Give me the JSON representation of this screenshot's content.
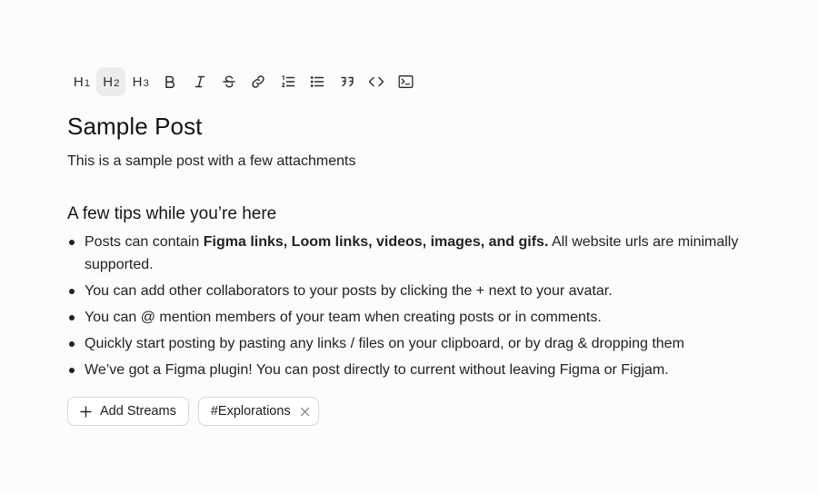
{
  "toolbar": {
    "h1": {
      "main": "H",
      "sub": "1"
    },
    "h2": {
      "main": "H",
      "sub": "2"
    },
    "h3": {
      "main": "H",
      "sub": "3"
    },
    "bold": "B",
    "buttons": [
      "heading-1",
      "heading-2",
      "heading-3",
      "bold",
      "italic",
      "strikethrough",
      "link",
      "ordered-list",
      "bullet-list",
      "quote",
      "code",
      "code-block"
    ],
    "active": "heading-2"
  },
  "post": {
    "title": "Sample Post",
    "subtitle": "This is a sample post with a few attachments"
  },
  "tips": {
    "heading": "A few tips while you’re here",
    "items": [
      {
        "before": "Posts can contain ",
        "bold": "Figma links, Loom links, videos, images, and gifs.",
        "after": " All website urls are minimally supported."
      },
      {
        "text": "You can add other collaborators to your posts by clicking the + next to your avatar."
      },
      {
        "text": "You can @ mention members of your team when creating posts or in comments."
      },
      {
        "text": "Quickly start posting by pasting any links / files on your clipboard, or by drag & dropping them"
      },
      {
        "text": "We’ve got a Figma plugin! You can post directly to current without leaving Figma or Figjam."
      }
    ]
  },
  "chips": {
    "add_label": "Add Streams",
    "stream_label": "#Explorations"
  },
  "icons": {
    "plus": "plus-icon",
    "remove": "close-icon"
  }
}
